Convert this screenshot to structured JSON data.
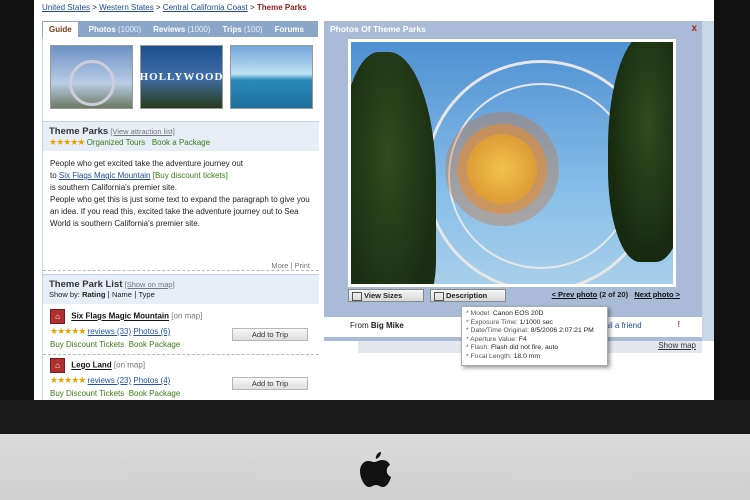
{
  "breadcrumb": [
    "United States",
    "Western States",
    "Central California Coast"
  ],
  "breadcrumb_current": "Theme Parks",
  "tabs": {
    "guide": "Guide",
    "photos": "Photos",
    "photos_count": "(1000)",
    "reviews": "Reviews",
    "reviews_count": "(1000)",
    "trips": "Trips",
    "trips_count": "(100)",
    "forums": "Forums"
  },
  "thumb_hollywood": "HOLLYWOOD",
  "attraction": {
    "title": "Theme Parks",
    "view_list": "[View attraction list]",
    "stars": "★★★★★",
    "organized_tours": "Organized Tours",
    "book_package": "Book a Package",
    "para_1": "People who get excited take the adventure journey out",
    "para_2_prefix": "to",
    "para_2_link": "Six Flags Magic Mountain",
    "para_2_discount": "[Buy discount tickets]",
    "para_3": "is southern California's premier site.",
    "para_4": "People who get this is just some text to expand the paragraph to give you an idea. If you read this, excited take the adventure journey out to Sea World is southern California's premier site.",
    "more": "More",
    "sep": "|",
    "print": "Print"
  },
  "list": {
    "title": "Theme Park List",
    "show_on_map": "[Show on map]",
    "show_by": "Show by:",
    "rating": "Rating",
    "name": "Name",
    "type": "Type",
    "items": [
      {
        "name": "Six Flags Magic Mountain",
        "on_map": "[on map]",
        "stars_on": "★★★★★",
        "stars_off": "",
        "reviews": "reviews (33)",
        "photos": "Photos (6)",
        "add": "Add to Trip",
        "tickets": "Buy Discount Tickets",
        "package": "Book Package"
      },
      {
        "name": "Lego Land",
        "on_map": "[on map]",
        "stars_on": "★★★",
        "stars_off": "★★",
        "reviews": "reviews (23)",
        "photos": "Photos (4)",
        "add": "Add to Trip",
        "tickets": "Buy Discount Tickets",
        "package": "Book Package"
      }
    ]
  },
  "photo": {
    "title": "Photos Of Theme Parks",
    "close": "x",
    "view_sizes": "View Sizes",
    "description": "Description",
    "prev": "< Prev photo",
    "counter": "(2 of 20)",
    "next": "Next photo >",
    "from_label": "From",
    "from_user": "Big Mike",
    "email_friend": "mail a friend",
    "flag": "!",
    "show_map": "Show map"
  },
  "exif": [
    {
      "k": "* Model:",
      "v": "Canon EOS 20D"
    },
    {
      "k": "* Exposure Time:",
      "v": "1/1000 sec"
    },
    {
      "k": "* Date/Time Original:",
      "v": "8/5/2006 2:07:21 PM"
    },
    {
      "k": "* Aperture Value:",
      "v": "F4"
    },
    {
      "k": "* Flash:",
      "v": "Flash did not fire, auto"
    },
    {
      "k": "* Focal Length:",
      "v": "18.0 mm"
    }
  ],
  "colors": {
    "tab_bar": "#8aa6c9",
    "photo_panel": "#a9bbd6",
    "link": "#1f4b99",
    "green_link": "#3a7d1a",
    "star": "#e8a300"
  }
}
